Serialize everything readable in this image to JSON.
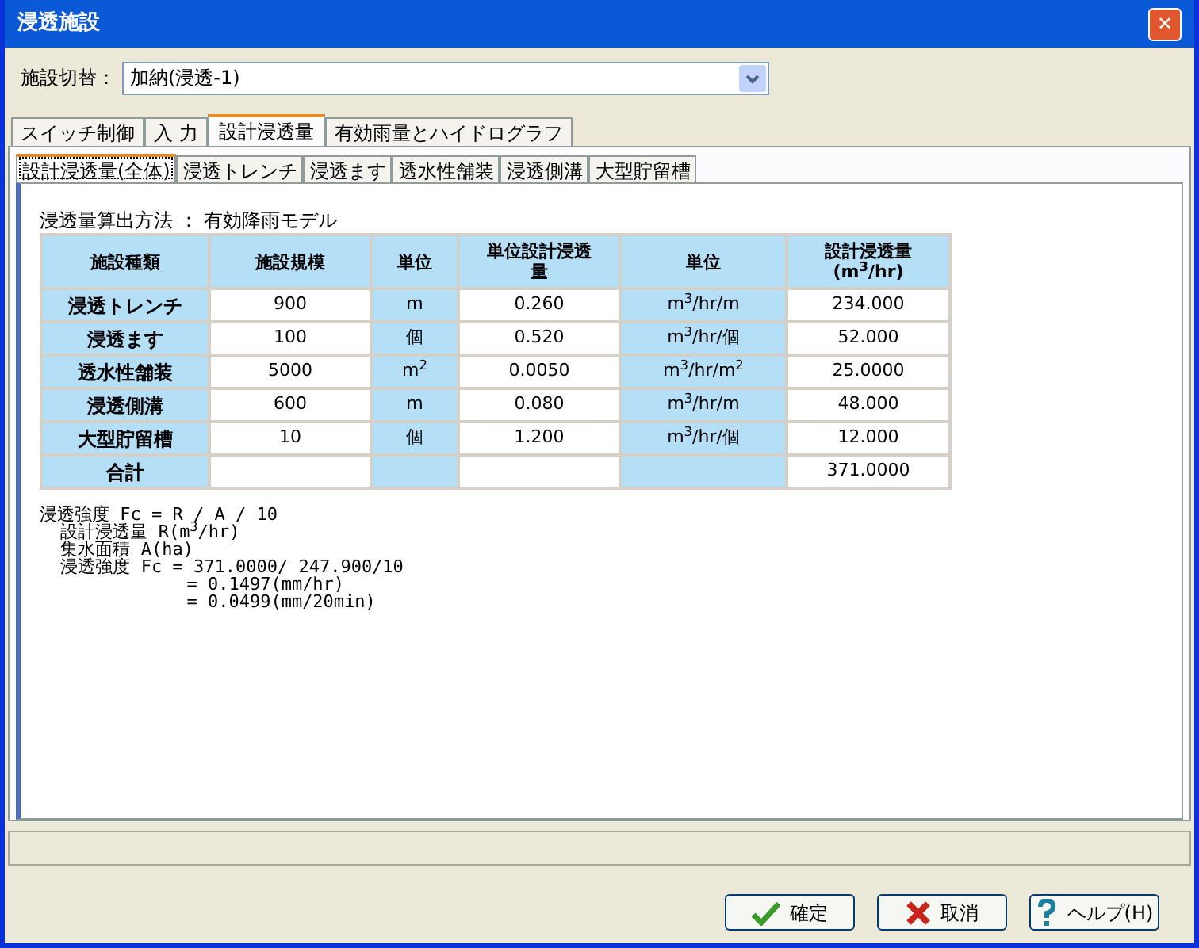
{
  "window": {
    "title": "浸透施設",
    "close": "✕"
  },
  "facility_switch": {
    "label": "施設切替：",
    "value": "加納(浸透-1)"
  },
  "tabs": [
    {
      "label": "スイッチ制御",
      "selected": false
    },
    {
      "label": "入 力",
      "selected": false
    },
    {
      "label": "設計浸透量",
      "selected": true
    },
    {
      "label": "有効雨量とハイドログラフ",
      "selected": false
    }
  ],
  "sub_tabs": [
    {
      "label": "設計浸透量(全体)",
      "selected": true
    },
    {
      "label": "浸透トレンチ",
      "selected": false
    },
    {
      "label": "浸透ます",
      "selected": false
    },
    {
      "label": "透水性舗装",
      "selected": false
    },
    {
      "label": "浸透側溝",
      "selected": false
    },
    {
      "label": "大型貯留槽",
      "selected": false
    }
  ],
  "method": "浸透量算出方法 ： 有効降雨モデル",
  "table": {
    "columns": [
      {
        "lines": [
          "施設種類"
        ],
        "shaded": true
      },
      {
        "lines": [
          "施設規模"
        ],
        "shaded": false
      },
      {
        "lines": [
          "単位"
        ],
        "shaded": true
      },
      {
        "lines": [
          "単位設計浸透",
          "量"
        ],
        "shaded": false
      },
      {
        "lines": [
          "単位"
        ],
        "shaded": true
      },
      {
        "lines": [
          "設計浸透量",
          "(m$^{3}$/hr)"
        ],
        "shaded": false
      }
    ],
    "rows": [
      [
        "浸透トレンチ",
        "900",
        "m",
        "0.260",
        "m$^{3}$/hr/m",
        "234.000"
      ],
      [
        "浸透ます",
        "100",
        "個",
        "0.520",
        "m$^{3}$/hr/個",
        "52.000"
      ],
      [
        "透水性舗装",
        "5000",
        "m$^{2}$",
        "0.0050",
        "m$^{3}$/hr/m$^{2}$",
        "25.0000"
      ],
      [
        "浸透側溝",
        "600",
        "m",
        "0.080",
        "m$^{3}$/hr/m",
        "48.000"
      ],
      [
        "大型貯留槽",
        "10",
        "個",
        "1.200",
        "m$^{3}$/hr/個",
        "12.000"
      ],
      [
        "合計",
        "",
        "",
        "",
        "",
        "371.0000"
      ]
    ]
  },
  "formula": [
    "浸透強度 Fc = R / A / 10",
    "  設計浸透量 R(m$^{3}$/hr)",
    "  集水面積 A(ha)",
    "  浸透強度 Fc = 371.0000/ 247.900/10",
    "              = 0.1497(mm/hr)",
    "              = 0.0499(mm/20min)"
  ],
  "buttons": [
    {
      "kind": "ok",
      "label": "確定"
    },
    {
      "kind": "cancel",
      "label": "取消"
    },
    {
      "kind": "help",
      "label": "ヘルプ(H)"
    }
  ]
}
